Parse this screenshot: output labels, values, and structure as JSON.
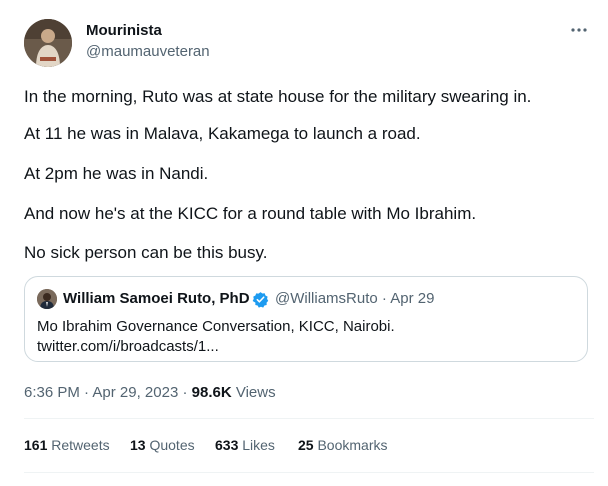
{
  "author": {
    "name": "Mourinista",
    "handle": "@maumauveteran"
  },
  "tweet_lines": [
    "In the morning, Ruto was at state house for the military swearing in.",
    "At 11 he was in Malava, Kakamega to launch a road.",
    "At 2pm he was in Nandi.",
    "And now he's at the KICC for a round table with Mo Ibrahim.",
    "No sick person can be this busy."
  ],
  "quoted": {
    "name": "William Samoei Ruto, PhD",
    "handle": "@WilliamsRuto",
    "separator": "·",
    "date": "Apr 29",
    "text": "Mo Ibrahim Governance Conversation, KICC, Nairobi.",
    "link": "twitter.com/i/broadcasts/1..."
  },
  "meta": {
    "time": "6:36 PM",
    "separator": "·",
    "date": "Apr 29, 2023",
    "views_count": "98.6K",
    "views_label": "Views"
  },
  "stats": {
    "retweets_count": "161",
    "retweets_label": "Retweets",
    "quotes_count": "13",
    "quotes_label": "Quotes",
    "likes_count": "633",
    "likes_label": "Likes",
    "bookmarks_count": "25",
    "bookmarks_label": "Bookmarks"
  },
  "colors": {
    "text": "#0f1419",
    "secondary": "#536471",
    "verified": "#1d9bf0",
    "border": "#cfd9de"
  },
  "icons": {
    "more": "more-dots-icon",
    "verified": "verified-badge-icon"
  }
}
